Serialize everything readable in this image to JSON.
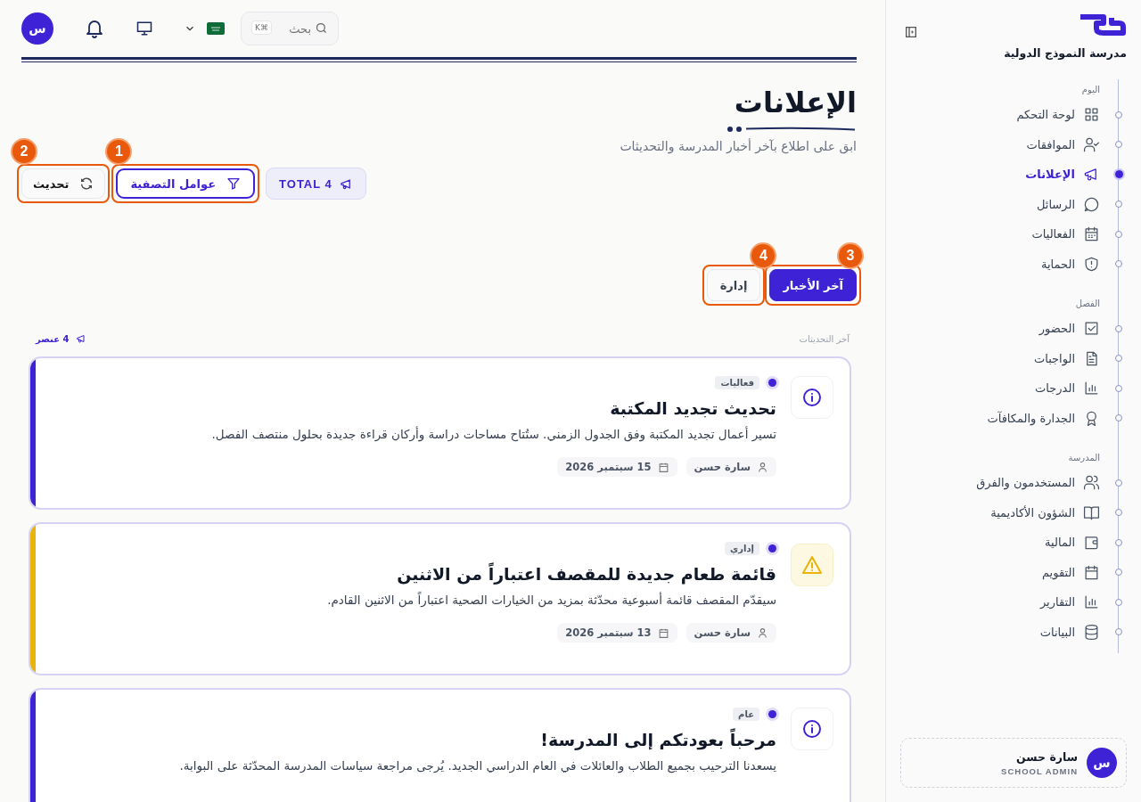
{
  "header": {
    "avatar": "س",
    "search": {
      "placeholder": "بحث",
      "shortcut": "K⌘"
    }
  },
  "sidebar": {
    "school_name": "مدرسة النموذج الدولية",
    "sections": [
      {
        "label": "اليوم",
        "items": [
          {
            "label": "لوحة التحكم",
            "selected": false
          },
          {
            "label": "الموافقات",
            "selected": false
          },
          {
            "label": "الإعلانات",
            "selected": true
          },
          {
            "label": "الرسائل",
            "selected": false
          },
          {
            "label": "الفعاليات",
            "selected": false
          },
          {
            "label": "الحماية",
            "selected": false
          }
        ]
      },
      {
        "label": "الفصل",
        "items": [
          {
            "label": "الحضور",
            "selected": false
          },
          {
            "label": "الواجبات",
            "selected": false
          },
          {
            "label": "الدرجات",
            "selected": false
          },
          {
            "label": "الجدارة والمكافآت",
            "selected": false
          }
        ]
      },
      {
        "label": "المدرسة",
        "items": [
          {
            "label": "المستخدمون والفرق",
            "selected": false
          },
          {
            "label": "الشؤون الأكاديمية",
            "selected": false
          },
          {
            "label": "المالية",
            "selected": false
          },
          {
            "label": "التقويم",
            "selected": false
          },
          {
            "label": "التقارير",
            "selected": false
          },
          {
            "label": "البيانات",
            "selected": false
          }
        ]
      }
    ],
    "user": {
      "avatar": "س",
      "name": "سارة حسن",
      "role": "SCHOOL ADMIN"
    }
  },
  "page": {
    "title": "الإعلانات",
    "subtitle": "ابق على اطلاع بآخر أخبار المدرسة والتحديثات",
    "total": "TOTAL 4",
    "filter_button": {
      "label": "عوامل التصفية",
      "callout": "1"
    },
    "refresh_button": {
      "label": "تحديث",
      "callout": "2"
    }
  },
  "tabs": [
    {
      "label": "آخر الأخبار",
      "selected": true,
      "callout": "3"
    },
    {
      "label": "إدارة",
      "selected": false,
      "callout": "4"
    }
  ],
  "list": {
    "heading": "آخر التحديثات",
    "count": "4 عنصر"
  },
  "announcements": [
    {
      "kind": "info",
      "color": "#3d22d6",
      "tag": "فعاليات",
      "title": "تحديث تجديد المكتبة",
      "body": "تسير أعمال تجديد المكتبة وفق الجدول الزمني. ستُتاح مساحات دراسة وأركان قراءة جديدة بحلول منتصف الفصل.",
      "author": "سارة حسن",
      "date": "15 سبتمبر 2026"
    },
    {
      "kind": "warning",
      "color": "#eab308",
      "tag": "إداري",
      "title": "قائمة طعام جديدة للمقصف اعتباراً من الاثنين",
      "body": "سيقدّم المقصف قائمة أسبوعية محدّثة بمزيد من الخيارات الصحية اعتباراً من الاثنين القادم.",
      "author": "سارة حسن",
      "date": "13 سبتمبر 2026"
    },
    {
      "kind": "info",
      "color": "#3d22d6",
      "tag": "عام",
      "title": "مرحباً بعودتكم إلى المدرسة!",
      "body": "يسعدنا الترحيب بجميع الطلاب والعائلات في العام الدراسي الجديد. يُرجى مراجعة سياسات المدرسة المحدّثة على البوابة."
    }
  ]
}
